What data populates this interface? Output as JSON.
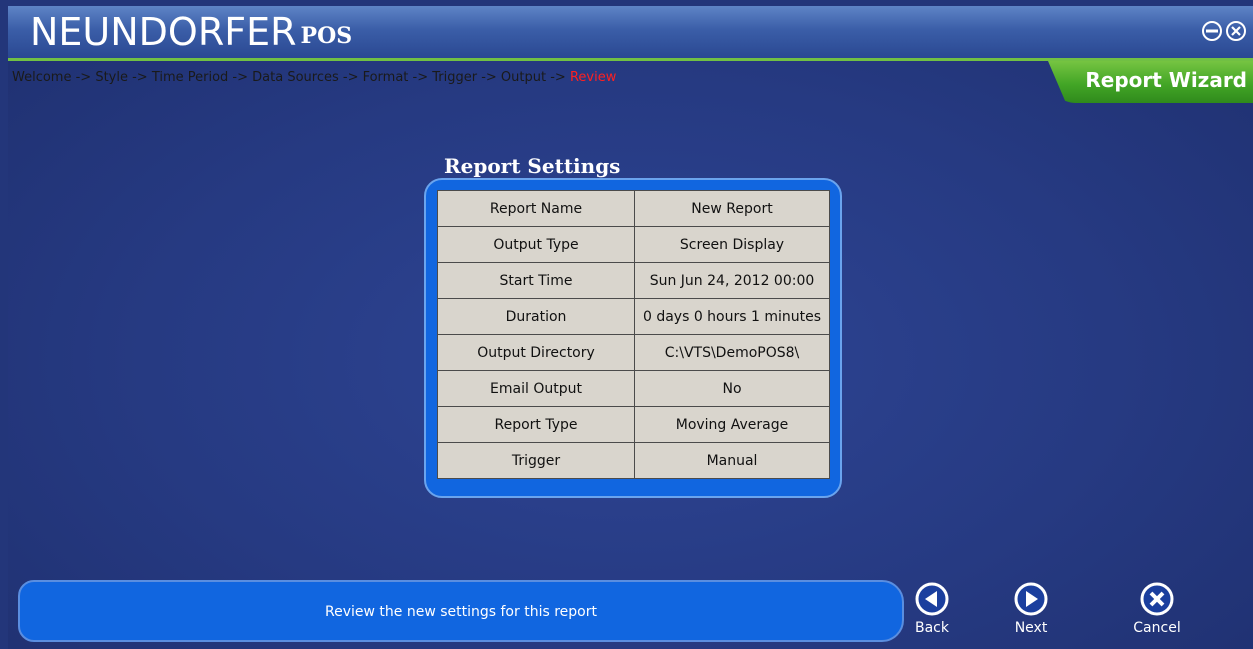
{
  "app": {
    "brand": "NEUNDORFER",
    "brand_sub": "POS"
  },
  "breadcrumb": {
    "trail": "Welcome -> Style -> Time Period -> Data Sources -> Format -> Trigger -> Output -> ",
    "current": "Review"
  },
  "wizard_tab": {
    "label": "Report Wizard"
  },
  "settings": {
    "title": "Report Settings",
    "rows": [
      {
        "key": "Report Name",
        "value": "New Report"
      },
      {
        "key": "Output Type",
        "value": "Screen Display"
      },
      {
        "key": "Start Time",
        "value": "Sun Jun 24, 2012 00:00"
      },
      {
        "key": "Duration",
        "value": "0 days 0 hours 1 minutes"
      },
      {
        "key": "Output Directory",
        "value": "C:\\VTS\\DemoPOS8\\"
      },
      {
        "key": "Email Output",
        "value": "No"
      },
      {
        "key": "Report Type",
        "value": "Moving Average"
      },
      {
        "key": "Trigger",
        "value": "Manual"
      }
    ]
  },
  "status": {
    "message": "Review the new settings for this report"
  },
  "nav": {
    "back": "Back",
    "next": "Next",
    "cancel": "Cancel"
  },
  "icons": {
    "minimize": "minimize-icon",
    "close": "close-icon",
    "back": "back-arrow-icon",
    "next": "next-arrow-icon",
    "cancel": "cancel-x-icon"
  },
  "colors": {
    "accent_green": "#43a626",
    "panel_blue": "#1166e0",
    "breadcrumb_current": "#ff2020"
  }
}
